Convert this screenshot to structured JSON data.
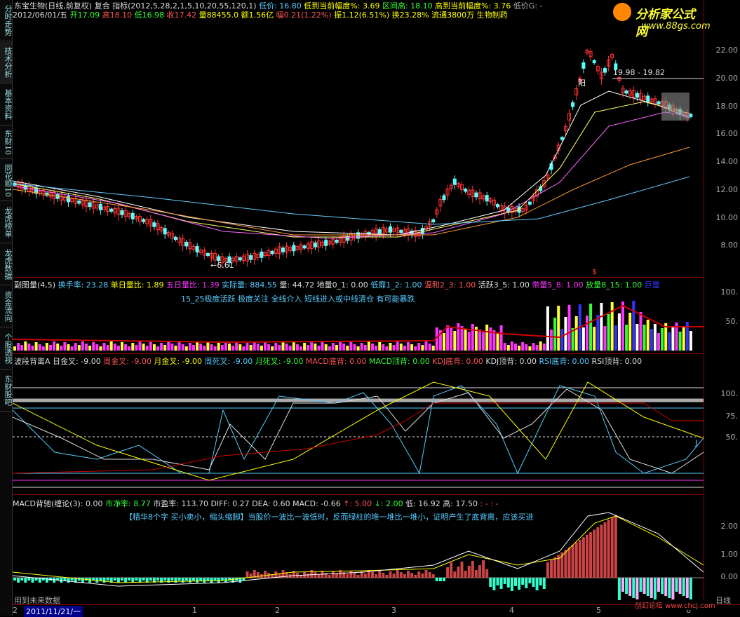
{
  "sidebar": {
    "tabs": [
      "分时走势",
      "技术分析",
      "基本资料",
      "东财10",
      "同花顺10",
      "龙虎榜单",
      "龙虎数据",
      "资金流向",
      "个股透视",
      "东财股吧"
    ]
  },
  "main_panel": {
    "line1": "东宝生物(日线,前复权) 复合 指标(2012,5,28,2,1,5,10,20,55,120,1)",
    "line1_low": "低价: 16.80",
    "line1_lowpct": "低到当前幅度%: 3.69",
    "line1_range": "区间高: 18.10",
    "line1_highpct": "高到当前幅度%: 3.76",
    "line1_lowg": "低价G: -",
    "line2_date": "2012/06/01/五",
    "line2_open": "开17.09",
    "line2_high": "高18.10",
    "line2_low": "低16.98",
    "line2_close": "收17.42",
    "line2_vol": "量88455.0",
    "line2_amt": "额1.56亿",
    "line2_pct": "幅0.21(1.22%)",
    "line2_amp": "振1.12(6.51%)",
    "line2_turn": "换23.28%",
    "line2_float": "流通3800万",
    "line2_sector": "生物制药",
    "annotation_high": "19.98 - 19.82",
    "annotation_low": "6.61",
    "annotation_yang": "阳",
    "axis_ticks": [
      "22.00",
      "20.00",
      "18.00",
      "16.00",
      "14.00",
      "12.00",
      "10.00",
      "8.00"
    ]
  },
  "logo": {
    "text": "分析家公式网",
    "url": "www.88gs.com"
  },
  "volume_panel": {
    "header": [
      "副图量(4,5)",
      "换手率: 23.28",
      "单日量比: 1.89",
      "五日量比: 1.39",
      "实际量: 884.55",
      "量: 44.72",
      "地量0_1: 0.00",
      "低靡1_2: 1.00",
      "温和2_3: 1.00",
      "活跃3_5: 1.00",
      "带量5_8: 1.00",
      "放量8_15: 1.00",
      "巨量"
    ],
    "header_colors": [
      "#ddd",
      "#5cf",
      "#ff0",
      "#f3f",
      "#5cf",
      "#ddd",
      "#ddd",
      "#5cf",
      "#f55",
      "#ddd",
      "#f3f",
      "#3f3",
      "#33f"
    ],
    "note": "15_25极度活跃 极度关注 全线介入 短线进入或中线清仓 有可能暴跌",
    "axis_ticks": [
      "100.",
      "50."
    ]
  },
  "osc_panel": {
    "header": [
      "波段背离A",
      "日金叉: -9.00",
      "周金叉: -9.00",
      "月金叉: -9.00",
      "周死叉: -9.00",
      "月死叉: -9.00",
      "MACD底背: 0.00",
      "MACD顶背: 0.00",
      "KDJ底背: 0.00",
      "KDJ顶背: 0.00",
      "RSI底背: 0.00",
      "RSI顶背: 0.00"
    ],
    "header_colors": [
      "#ddd",
      "#ddd",
      "#f55",
      "#ff0",
      "#5cf",
      "#3f3",
      "#f55",
      "#3f3",
      "#f55",
      "#ddd",
      "#5cf",
      "#ddd"
    ],
    "axis_ticks": [
      "100.",
      "75.",
      "50."
    ],
    "marker": "J"
  },
  "macd_panel": {
    "header": [
      "MACD背驰(缠论(3): 0.00",
      "市净率: 8.77",
      "市盈率: 113.70",
      "DIFF: 0.27",
      "DEA: 0.60",
      "MACD: -0.66",
      "↑: 5.00",
      "↓: 2.00",
      "低: 16.92",
      "高: 17.50",
      ":  - : -"
    ],
    "header_colors": [
      "#ddd",
      "#3f3",
      "#ddd",
      "#ddd",
      "#ddd",
      "#ddd",
      "#f55",
      "#3f3",
      "#ddd",
      "#ddd",
      "#f55"
    ],
    "note": "【精华8个字 买小卖小，缩头缩脚】当股价一波比一波低时，反而绿柱的堆一堆比一堆小，证明产生了底背离，应该买进",
    "axis_ticks": [
      "2.00",
      "1.00",
      "0.00"
    ],
    "footer_left": "用到未来数据"
  },
  "bottom_bar": {
    "date": "2011/11/21/一",
    "month_labels": [
      "2",
      "1",
      "2",
      "3",
      "4",
      "5",
      "6"
    ],
    "right_label": "日线",
    "watermark": "创幻论坛 www.chcj.com"
  },
  "colors": {
    "up": "#ff3333",
    "down": "#54ffff",
    "ma5": "#ffffff",
    "ma10": "#ffff66",
    "ma20": "#ff66ff",
    "ma55": "#ff9933",
    "ma120": "#66ccff",
    "axis_red": "#8b0000"
  }
}
